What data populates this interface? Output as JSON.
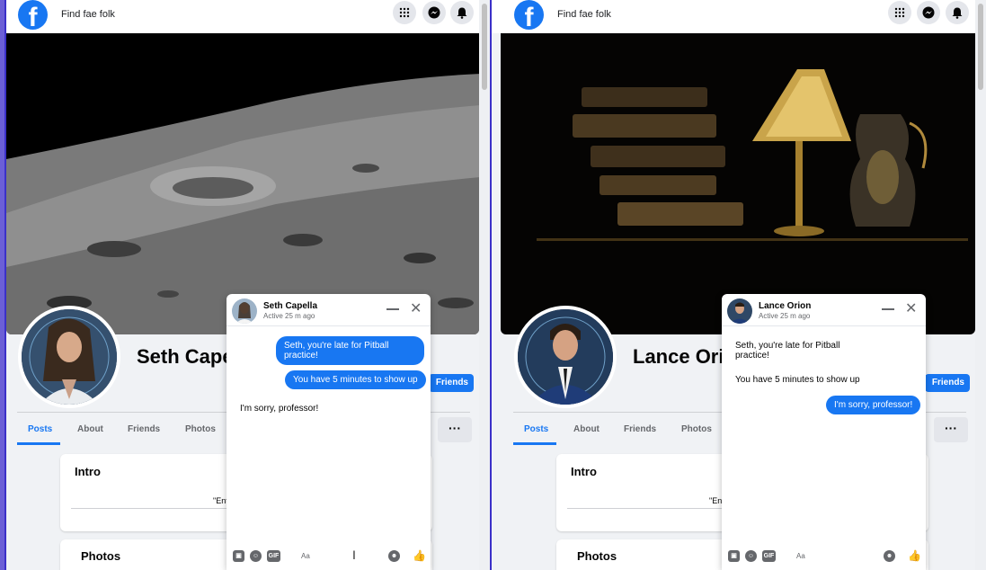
{
  "left": {
    "search_placeholder": "Find fae folk",
    "profile_name": "Seth Capella",
    "friends_button": "Friends",
    "tabs": [
      "Posts",
      "About",
      "Friends",
      "Photos"
    ],
    "more_button": "···",
    "intro_title": "Intro",
    "intro_snippet": "\"Ent",
    "photos_title": "Photos",
    "chat": {
      "name": "Seth Capella",
      "status": "Active 25 m ago",
      "messages": [
        {
          "from": "me",
          "text": "Seth, you're late for Pitball practice!"
        },
        {
          "from": "me",
          "text": "You have 5 minutes to show up"
        },
        {
          "from": "them",
          "text": "I'm sorry, professor!"
        }
      ],
      "input_placeholder": "Aa"
    }
  },
  "right": {
    "search_placeholder": "Find fae folk",
    "profile_name": "Lance Orion",
    "friends_button": "Friends",
    "tabs": [
      "Posts",
      "About",
      "Friends",
      "Photos"
    ],
    "more_button": "···",
    "intro_title": "Intro",
    "intro_snippet": "\"Ent",
    "photos_title": "Photos",
    "chat": {
      "name": "Lance Orion",
      "status": "Active 25 m ago",
      "messages": [
        {
          "from": "them",
          "text": "Seth, you're late for Pitball practice!"
        },
        {
          "from": "them",
          "text": "You have 5 minutes to show up"
        },
        {
          "from": "me",
          "text": "I'm sorry, professor!"
        }
      ],
      "input_placeholder": "Aa"
    }
  },
  "colors": {
    "brand": "#1877f2",
    "page_bg": "#f0f2f5",
    "divider": "#3b30c8"
  },
  "icons": [
    "facebook-logo-icon",
    "menu-grid-icon",
    "messenger-icon",
    "bell-icon",
    "minimize-icon",
    "close-icon",
    "image-icon",
    "sticker-icon",
    "gif-icon",
    "emoji-icon",
    "like-icon"
  ]
}
